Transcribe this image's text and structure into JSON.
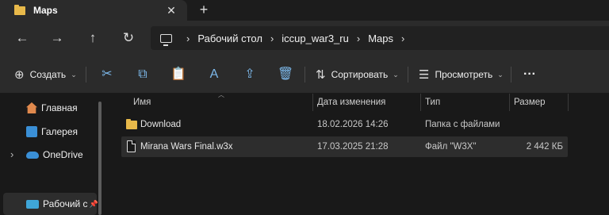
{
  "tab": {
    "title": "Maps",
    "close_glyph": "✕",
    "new_glyph": "+"
  },
  "nav": {
    "back": "←",
    "forward": "→",
    "up": "↑",
    "refresh": "↻"
  },
  "breadcrumb": {
    "sep": "›",
    "items": [
      "Рабочий стол",
      "iccup_war3_ru",
      "Maps"
    ]
  },
  "toolbar": {
    "create_label": "Создать",
    "sort_label": "Сортировать",
    "view_label": "Просмотреть",
    "more_glyph": "···",
    "icons": {
      "create": "⊕",
      "cut": "✂",
      "copy": "⧉",
      "paste": "📋",
      "rename": "A",
      "share": "⇪",
      "delete": "🗑",
      "sort": "⇅",
      "view": "☰"
    }
  },
  "sidebar": {
    "items": [
      {
        "label": "Главная",
        "icon": "home-icon",
        "color": "#e0894d"
      },
      {
        "label": "Галерея",
        "icon": "gallery-icon",
        "color": "#3a8fd6"
      },
      {
        "label": "OneDrive",
        "icon": "cloud-icon",
        "color": "#3a8fd6",
        "expand": "›"
      },
      {
        "label": "Рабочий с",
        "icon": "desktop-icon",
        "color": "#3fa6d8",
        "pin": "📌"
      }
    ]
  },
  "columns": {
    "name": "Имя",
    "date": "Дата изменения",
    "type": "Тип",
    "size": "Размер"
  },
  "files": [
    {
      "name": "Download",
      "date": "18.02.2026 14:26",
      "type": "Папка с файлами",
      "size": "",
      "kind": "folder"
    },
    {
      "name": "Mirana Wars Final.w3x",
      "date": "17.03.2025 21:28",
      "type": "Файл \"W3X\"",
      "size": "2 442 КБ",
      "kind": "file"
    }
  ],
  "colors": {
    "folder": "#e8b94a",
    "accent": "#7cb8ea"
  }
}
